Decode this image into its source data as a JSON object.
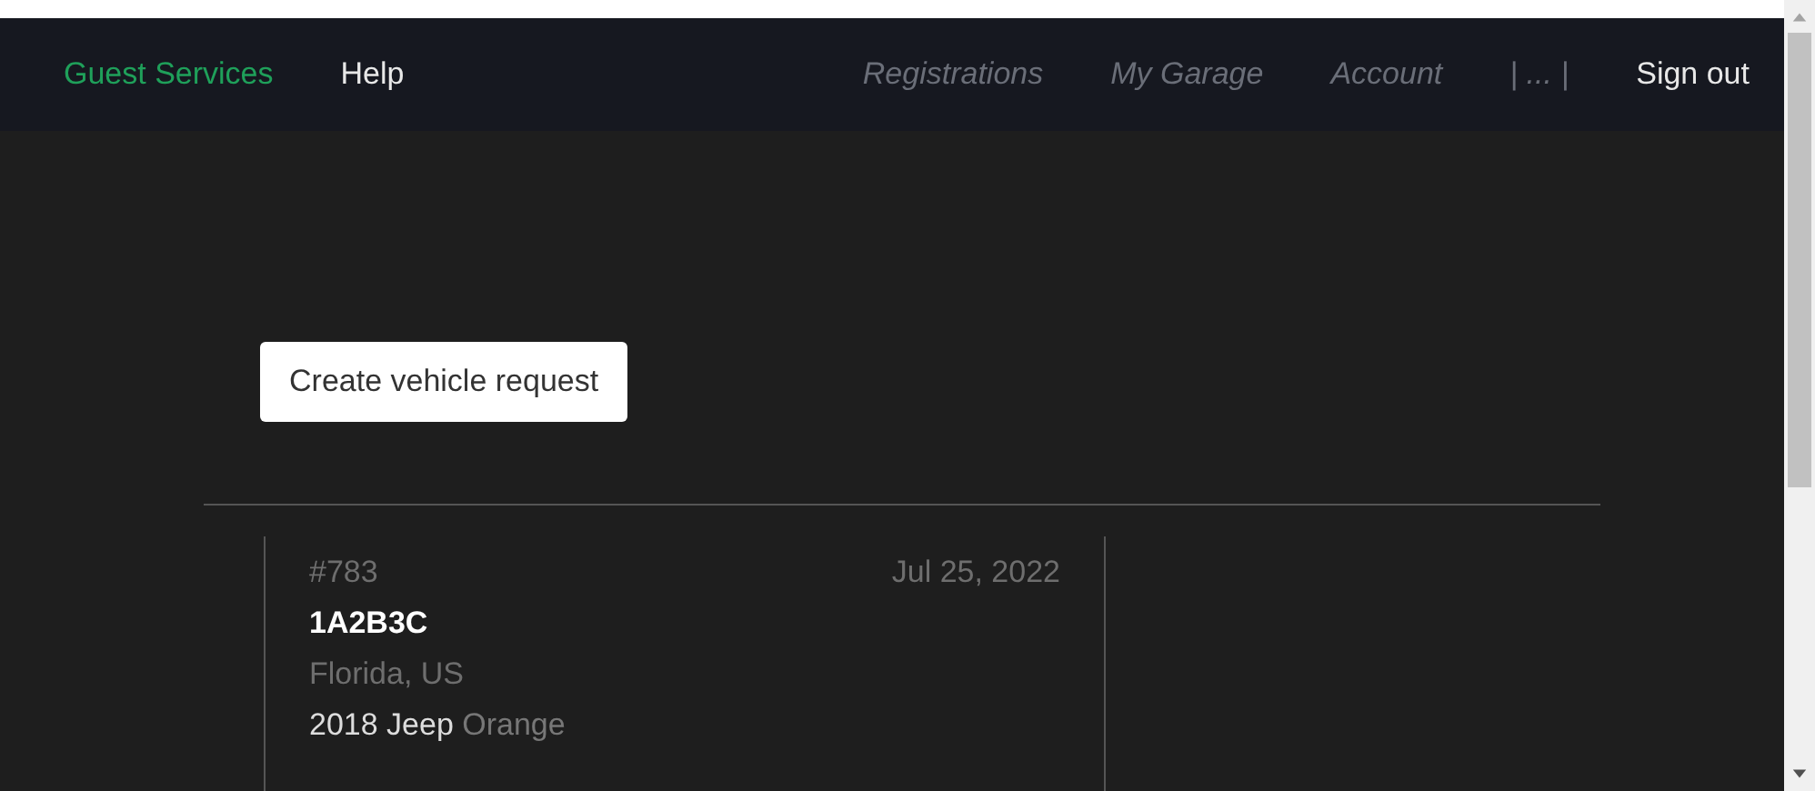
{
  "nav": {
    "brand": "Guest Services",
    "left": [
      {
        "label": "Help"
      }
    ],
    "right": [
      {
        "label": "Registrations",
        "italic": true
      },
      {
        "label": "My Garage",
        "italic": true
      },
      {
        "label": "Account",
        "italic": true
      },
      {
        "label": "| ... |",
        "italic": true
      },
      {
        "label": "Sign out",
        "italic": false
      }
    ]
  },
  "create_button": "Create vehicle request",
  "requests": [
    {
      "number": "#783",
      "date": "Jul 25, 2022",
      "plate": "1A2B3C",
      "region": "Florida, US",
      "vehicle": "**2018 Jeep** Orange"
    }
  ]
}
